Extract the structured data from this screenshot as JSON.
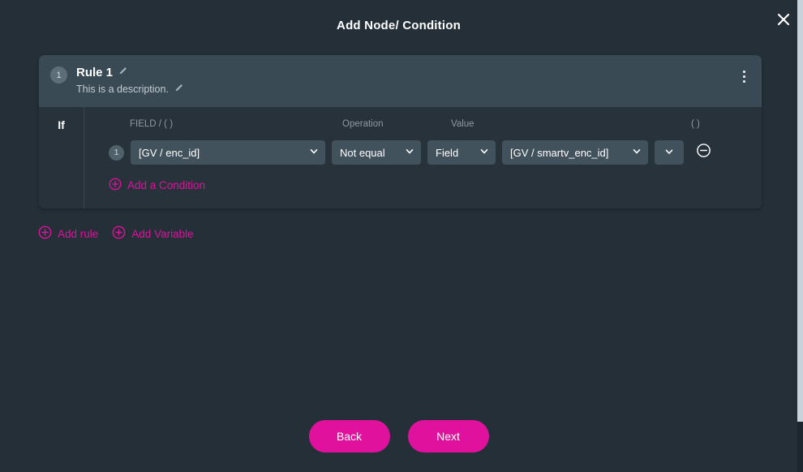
{
  "modal": {
    "title": "Add Node/ Condition",
    "close_icon": "close-icon"
  },
  "rule": {
    "badge": "1",
    "title": "Rule 1",
    "description": "This is a description.",
    "title_edit_icon": "pencil-icon",
    "desc_edit_icon": "pencil-icon",
    "menu_icon": "kebab-menu-icon"
  },
  "condition_block": {
    "if_label": "If",
    "headers": {
      "field": "FIELD / ( )",
      "operation": "Operation",
      "value": "Value",
      "paren": "( )"
    },
    "rows": [
      {
        "badge": "1",
        "field": "[GV / enc_id]",
        "operation": "Not equal",
        "value_type": "Field",
        "value": "[GV / smartv_enc_id]",
        "paren": "",
        "remove_icon": "minus-circle-icon",
        "dropdown_icon": "chevron-down-icon"
      }
    ],
    "add_condition": {
      "label": "Add a Condition",
      "icon": "plus-circle-icon"
    }
  },
  "actions": {
    "add_rule": {
      "label": "Add rule",
      "icon": "plus-circle-icon"
    },
    "add_variable": {
      "label": "Add Variable",
      "icon": "plus-circle-icon"
    }
  },
  "footer": {
    "back_label": "Back",
    "next_label": "Next"
  },
  "colors": {
    "background": "#242f38",
    "card_head": "#3a4a54",
    "card_body": "#27323b",
    "select": "#42525d",
    "accent": "#e0119d",
    "text": "#ffffff",
    "muted": "#8d9aa4"
  }
}
